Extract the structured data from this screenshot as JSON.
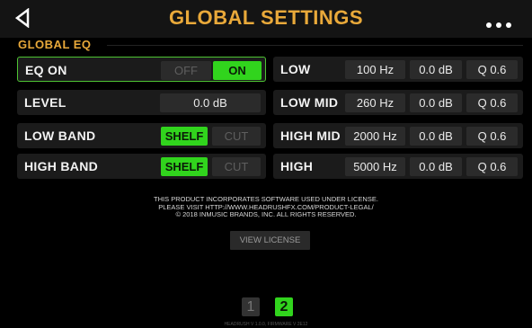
{
  "header": {
    "title": "GLOBAL SETTINGS",
    "back_icon": "back-triangle-icon",
    "more_icon": "more-dots-icon"
  },
  "section": {
    "label": "GLOBAL EQ"
  },
  "left_rows": {
    "eq_on": {
      "label": "EQ ON",
      "off": "OFF",
      "on": "ON",
      "selected": "ON"
    },
    "level": {
      "label": "LEVEL",
      "value": "0.0 dB"
    },
    "low_band": {
      "label": "LOW BAND",
      "shelf": "SHELF",
      "cut": "CUT",
      "selected": "SHELF"
    },
    "high_band": {
      "label": "HIGH BAND",
      "shelf": "SHELF",
      "cut": "CUT",
      "selected": "SHELF"
    }
  },
  "bands": [
    {
      "label": "LOW",
      "freq": "100 Hz",
      "gain": "0.0 dB",
      "q": "Q 0.6"
    },
    {
      "label": "LOW MID",
      "freq": "260 Hz",
      "gain": "0.0 dB",
      "q": "Q 0.6"
    },
    {
      "label": "HIGH MID",
      "freq": "2000 Hz",
      "gain": "0.0 dB",
      "q": "Q 0.6"
    },
    {
      "label": "HIGH",
      "freq": "5000 Hz",
      "gain": "0.0 dB",
      "q": "Q 0.6"
    }
  ],
  "legal": {
    "line1": "THIS PRODUCT INCORPORATES SOFTWARE USED UNDER LICENSE.",
    "line2": "PLEASE VISIT HTTP://WWW.HEADRUSHFX.COM/PRODUCT-LEGAL/",
    "line3": "© 2018 INMUSIC BRANDS, INC. ALL RIGHTS RESERVED."
  },
  "view_license": "VIEW LICENSE",
  "pages": {
    "p1": "1",
    "p2": "2",
    "current": "2"
  },
  "version": "HEADRUSH V 1.0.0, FIRMWARE V 2E12",
  "colors": {
    "accent": "#e9a93a",
    "active_green": "#31d41d",
    "row_bg": "#1b1b1b",
    "cell_bg": "#2b2b2b"
  }
}
